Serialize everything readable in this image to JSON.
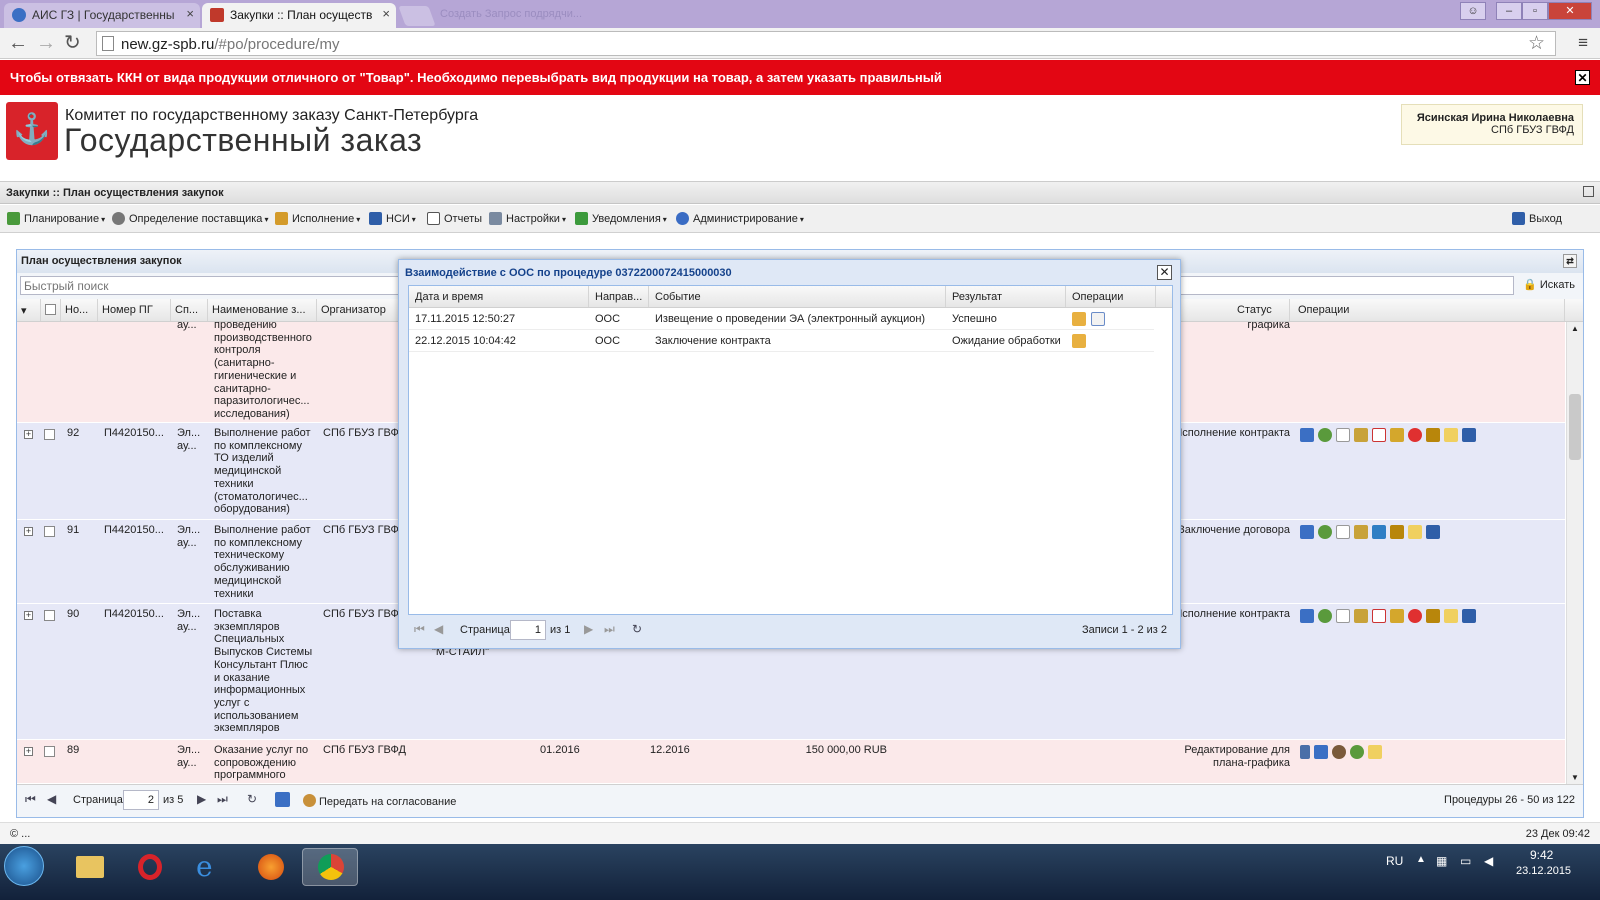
{
  "browser": {
    "tabs": [
      {
        "label": "АИС ГЗ | Государственны",
        "active": false
      },
      {
        "label": "Закупки :: План осуществ",
        "active": true
      }
    ],
    "ghost_tab": "Создать Запрос подрядчи...",
    "url_domain": "new.gz-spb.ru",
    "url_path": "/#po/procedure/my"
  },
  "alert": {
    "text": "Чтобы отвязать ККН от вида продукции отличного от \"Товар\". Необходимо перевыбрать вид продукции на товар, а затем указать правильный"
  },
  "header": {
    "org_line1": "Комитет по государственному заказу Санкт-Петербурга",
    "org_line2": "Государственный заказ",
    "user_name": "Ясинская Ирина Николаевна",
    "user_org": "СПб ГБУЗ ГВФД"
  },
  "page_title": "Закупки :: План осуществления закупок",
  "menu": {
    "items": [
      "Планирование",
      "Определение поставщика",
      "Исполнение",
      "НСИ",
      "Отчеты",
      "Настройки",
      "Уведомления",
      "Администрирование"
    ],
    "logout": "Выход"
  },
  "grid": {
    "title": "План осуществления закупок",
    "search_placeholder": "Быстрый поиск",
    "search_button": "Искать",
    "columns": [
      "Но...",
      "Номер ПГ",
      "Сп...",
      "Наименование з...",
      "Организатор",
      "Статус",
      "Операции"
    ],
    "rows": [
      {
        "no": "",
        "pg": "",
        "sp": "ау...",
        "name": "проведению производственного контроля (санитарно-гигиенические и санитарно-паразитологичес... исследования)",
        "org": "",
        "status": "графика",
        "month1": "",
        "month2": "",
        "price": ""
      },
      {
        "no": "92",
        "pg": "П4420150...",
        "sp": "Эл... ау...",
        "name": "Выполнение работ по комплексному ТО изделий медицинской техники (стоматологичес... оборудования)",
        "org": "СПб ГБУЗ ГВФ",
        "status": "Исполнение контракта",
        "month1": "",
        "month2": "",
        "price": ""
      },
      {
        "no": "91",
        "pg": "П4420150...",
        "sp": "Эл... ау...",
        "name": "Выполнение работ по комплексному техническому обслуживанию медицинской техники",
        "org": "СПб ГБУЗ ГВФ",
        "status": "Заключение договора",
        "month1": "",
        "month2": "",
        "price": ""
      },
      {
        "no": "90",
        "pg": "П4420150...",
        "sp": "Эл... ау...",
        "name": "Поставка экземпляров Специальных Выпусков Системы Консультант Плюс и оказание информационных услуг с использованием экземпляров",
        "org": "СПб ГБУЗ ГВФ",
        "status": "Исполнение контракта",
        "extra": "\"М-СТАЙЛ\"",
        "month1": "",
        "month2": "",
        "price": ""
      },
      {
        "no": "89",
        "pg": "",
        "sp": "Эл... ау...",
        "name": "Оказание услуг по сопровождению программного",
        "org": "СПб ГБУЗ ГВФД",
        "status": "Редактирование для плана-графика",
        "month1": "01.2016",
        "month2": "12.2016",
        "price": "150 000,00 RUB"
      }
    ],
    "pager": {
      "page_label": "Страница",
      "page": "2",
      "of": "из 5",
      "send_button": "Передать на согласование",
      "summary": "Процедуры 26 - 50 из 122"
    }
  },
  "modal": {
    "title": "Взаимодействие с ООС по процедуре 0372200072415000030",
    "columns": [
      "Дата и время",
      "Направ...",
      "Событие",
      "Результат",
      "Операции"
    ],
    "rows": [
      {
        "date": "17.11.2015 12:50:27",
        "dir": "ООС",
        "event": "Извещение о проведении ЭА (электронный аукцион)",
        "result": "Успешно"
      },
      {
        "date": "22.12.2015 10:04:42",
        "dir": "ООС",
        "event": "Заключение контракта",
        "result": "Ожидание обработки"
      }
    ],
    "pager": {
      "page_label": "Страница",
      "page": "1",
      "of": "из 1",
      "summary": "Записи 1 - 2 из 2"
    }
  },
  "footer": {
    "left": "© ...",
    "right": "23 Дек 09:42"
  },
  "taskbar": {
    "lang": "RU",
    "time": "9:42",
    "date": "23.12.2015"
  }
}
